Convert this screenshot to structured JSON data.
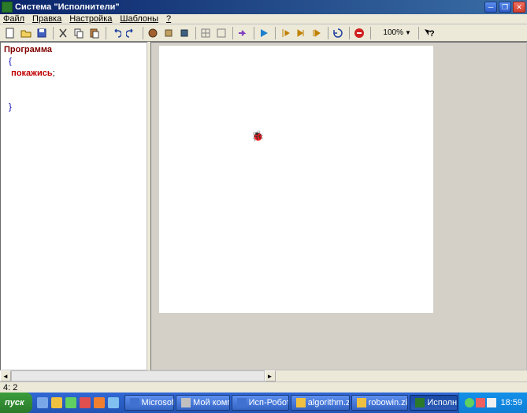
{
  "window": {
    "title": "Система \"Исполнители\""
  },
  "menu": {
    "file": "Файл",
    "edit": "Правка",
    "settings": "Настройка",
    "templates": "Шаблоны",
    "help": "?"
  },
  "toolbar": {
    "zoom": "100%"
  },
  "code": {
    "line1": "Программа",
    "line2": "  {",
    "line3_cmd": "   покажись",
    "line3_semi": ";",
    "line4": "  }"
  },
  "statusbar": {
    "pos": "4: 2"
  },
  "taskbar": {
    "start": "пуск",
    "tasks": [
      "Microsoft Off...",
      "Мой компьютер",
      "Исп-Робот_Чер...",
      "algorithm.zip - W...",
      "robowin.zip - Wi...",
      "Исполнители"
    ],
    "clock": "18:59"
  }
}
